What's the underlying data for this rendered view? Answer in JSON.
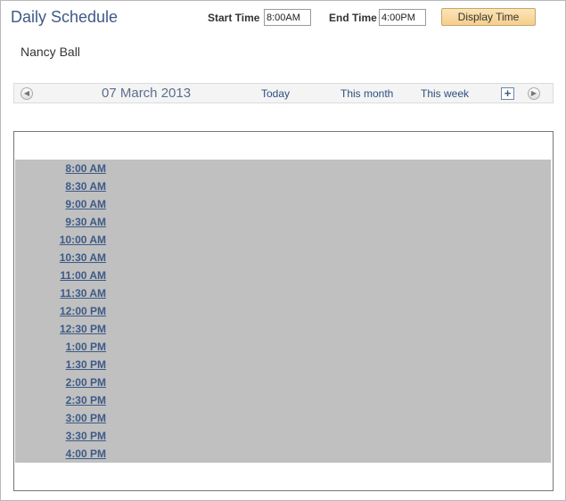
{
  "header": {
    "title": "Daily Schedule",
    "start_time_label": "Start Time",
    "start_time_value": "8:00AM",
    "end_time_label": "End Time",
    "end_time_value": "4:00PM",
    "display_button_label": "Display Time"
  },
  "person": {
    "name": "Nancy Ball"
  },
  "nav": {
    "prev_icon": "chevron-left-icon",
    "date": "07 March 2013",
    "today_label": "Today",
    "this_month_label": "This month",
    "this_week_label": "This week",
    "add_icon": "plus-icon",
    "next_icon": "chevron-right-icon"
  },
  "schedule": {
    "times": [
      "8:00 AM",
      "8:30 AM",
      "9:00 AM",
      "9:30 AM",
      "10:00 AM",
      "10:30 AM",
      "11:00 AM",
      "11:30 AM",
      "12:00 PM",
      "12:30 PM",
      "1:00 PM",
      "1:30 PM",
      "2:00 PM",
      "2:30 PM",
      "3:00 PM",
      "3:30 PM",
      "4:00 PM"
    ]
  },
  "colors": {
    "title": "#3e5a87",
    "link": "#2b4f81",
    "schedule_bg": "#c0c0c0",
    "button_bg": "#f5cf8c"
  }
}
